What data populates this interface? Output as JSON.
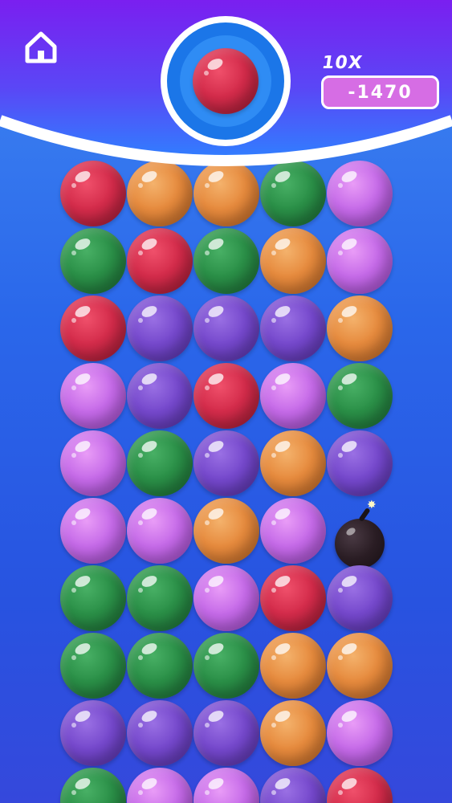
{
  "hud": {
    "multiplier": "10X",
    "score": "-1470",
    "current_bubble_color": "red"
  },
  "colors": {
    "banner_top": "#7a1ff0",
    "banner_bottom": "#2f80ff",
    "red": "#d32b4a",
    "orange": "#e68a3d",
    "green": "#2a8f47",
    "pink": "#c56ae8",
    "purple": "#7548cc"
  },
  "grid": {
    "rows": [
      [
        "red",
        "orange",
        "orange",
        "green",
        "pink"
      ],
      [
        "green",
        "red",
        "green",
        "orange",
        "pink"
      ],
      [
        "red",
        "purple",
        "purple",
        "purple",
        "orange"
      ],
      [
        "pink",
        "purple",
        "red",
        "pink",
        "green"
      ],
      [
        "pink",
        "green",
        "purple",
        "orange",
        "purple"
      ],
      [
        "pink",
        "pink",
        "orange",
        "pink",
        "bomb"
      ],
      [
        "green",
        "green",
        "pink",
        "red",
        "purple"
      ],
      [
        "green",
        "green",
        "green",
        "orange",
        "orange"
      ],
      [
        "purple",
        "purple",
        "purple",
        "orange",
        "pink"
      ],
      [
        "green",
        "pink",
        "pink",
        "purple",
        "red"
      ]
    ]
  }
}
